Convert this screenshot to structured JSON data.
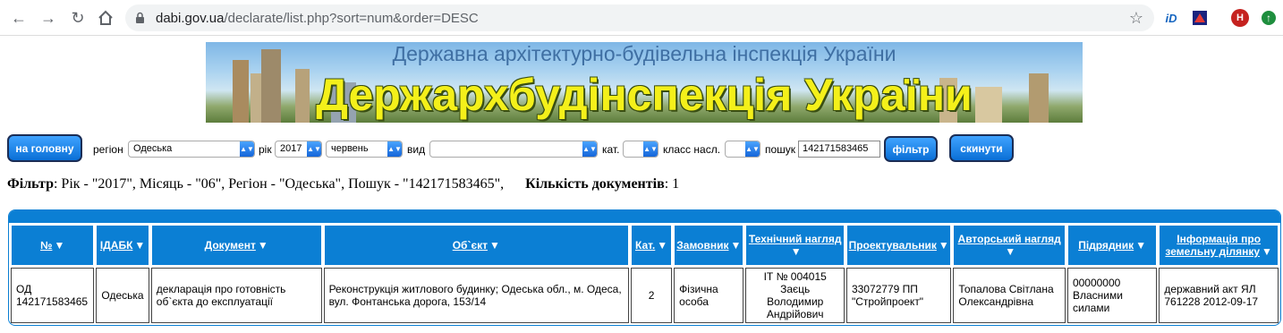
{
  "browser": {
    "url_host": "dabi.gov.ua",
    "url_path": "/declarate/list.php?sort=num&order=DESC",
    "avatar_letter": "H",
    "ext_id_label": "iD"
  },
  "banner": {
    "subtitle": "Державна архітектурно-будівельна інспекція України",
    "title": "Держархбудінспекція України"
  },
  "filters": {
    "home_button": "на головну",
    "region_label": "регіон",
    "region_value": "Одеська",
    "year_label": "рік",
    "year_value": "2017",
    "month_value": "червень",
    "type_label": "вид",
    "type_value": "",
    "cat_label": "кат.",
    "cat_value": "",
    "class_label": "класс насл.",
    "class_value": "",
    "search_label": "пошук",
    "search_value": "142171583465",
    "filter_button": "фільтр",
    "reset_button": "скинути"
  },
  "summary": {
    "filter_label": "Фільтр",
    "filter_text": ": Рік - \"2017\", Місяць - \"06\", Регіон - \"Одеська\", Пошук - \"142171583465\",",
    "count_label": "Кількість документів",
    "count_text": ": 1"
  },
  "table": {
    "headers": [
      "№",
      "ІДАБК",
      "Документ",
      "Об`єкт",
      "Кат.",
      "Замовник",
      "Технічний нагляд",
      "Проектувальник",
      "Авторський нагляд",
      "Підрядник",
      "Інформація про земельну ділянку"
    ],
    "rows": [
      {
        "num": "ОД 142171583465",
        "idabk": "Одеська",
        "document": "декларація про готовність об`єкта до експлуатації",
        "object": "Реконструкція житлового будинку; Одеська обл., м. Одеса, вул. Фонтанська дорога, 153/14",
        "cat": "2",
        "customer": "Фізична особа",
        "tech": "ІТ № 004015 Заєць Володимир Андрійович",
        "designer": "33072779 ПП \"Стройпроект\"",
        "author": "Топалова Світлана Олександрівна",
        "contractor": "00000000 Власними силами",
        "land": "державний акт ЯЛ 761228 2012-09-17"
      }
    ]
  },
  "colors": {
    "header_blue": "#0b7fd4",
    "button_blue": "#1e88f0",
    "banner_title_yellow": "#f4f01a"
  }
}
